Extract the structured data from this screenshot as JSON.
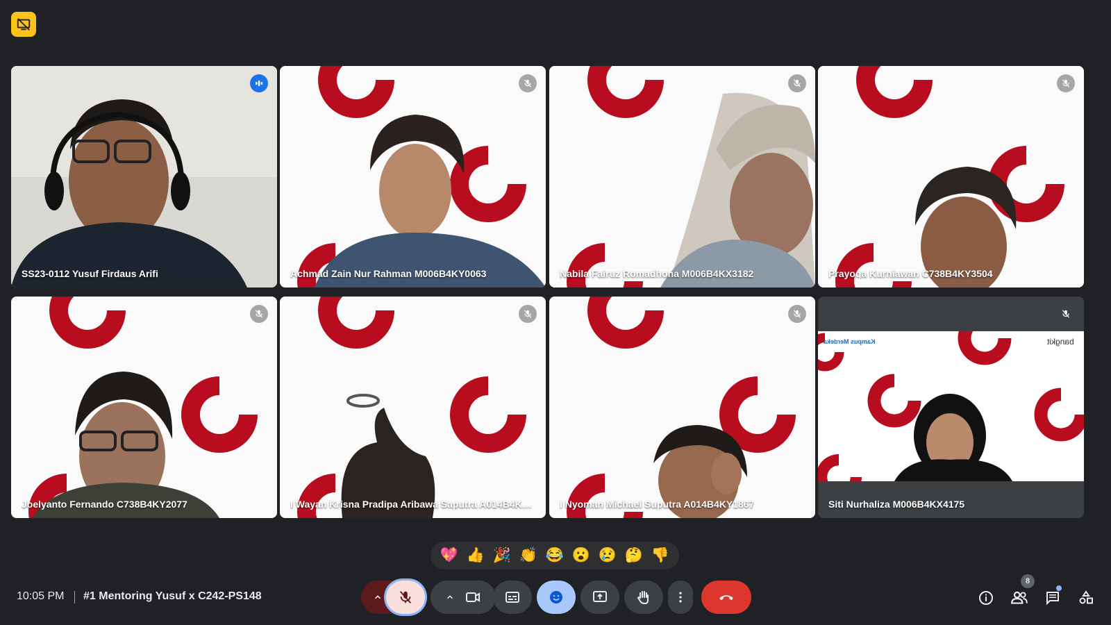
{
  "top_badge": {
    "icon": "no-screen-share-icon",
    "color": "#f9c41a"
  },
  "tiles": [
    {
      "name": "SS23-0112 Yusuf Firdaus Arifi",
      "state": "speaking"
    },
    {
      "name": "Achmad Zain Nur Rahman M006B4KY0063",
      "state": "muted"
    },
    {
      "name": "Nabila Fairuz Romadhona M006B4KX3182",
      "state": "muted"
    },
    {
      "name": "Prayoga Kurniawan C738B4KY3504",
      "state": "muted"
    },
    {
      "name": "Joelyanto Fernando C738B4KY2077",
      "state": "muted"
    },
    {
      "name": "I Wayan Krisna Pradipa Aribawa Saputra A014B4KY...",
      "state": "muted"
    },
    {
      "name": "I Nyoman Michael Suputra A014B4KY1867",
      "state": "muted"
    },
    {
      "name": "Siti Nurhaliza M006B4KX4175",
      "state": "muted"
    }
  ],
  "slide_logos": {
    "left": "Kampus Merdeka",
    "right": "bangkit"
  },
  "reactions": [
    "💖",
    "👍",
    "🎉",
    "👏",
    "😂",
    "😮",
    "😢",
    "🤔",
    "👎"
  ],
  "footer": {
    "time": "10:05 PM",
    "meeting_title": "#1 Mentoring Yusuf x C242-PS148",
    "participant_count": "8"
  },
  "colors": {
    "background": "#202124",
    "accent": "#8ab4f8",
    "end_call": "#ea4335",
    "brand_red": "#b80d1e",
    "mic_muted": "#f9dedc"
  }
}
